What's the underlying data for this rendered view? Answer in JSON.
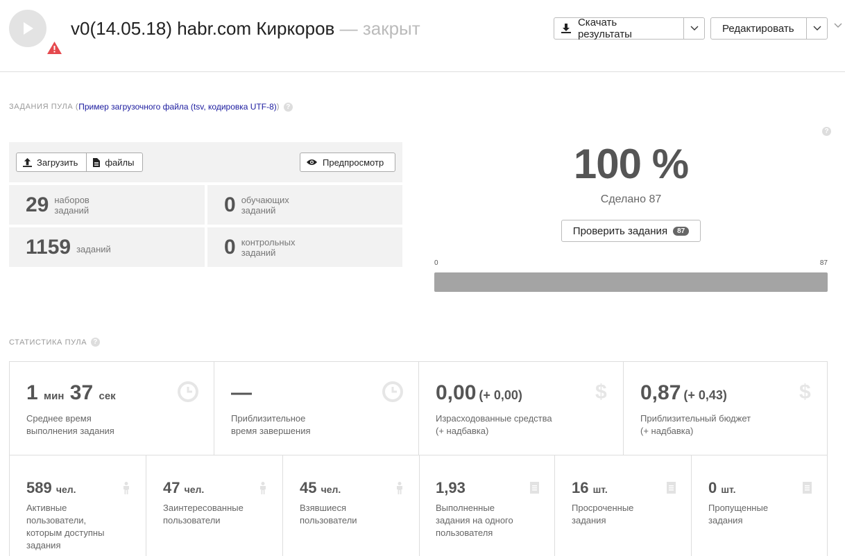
{
  "header": {
    "title": "v0(14.05.18) habr.com Киркоров",
    "status": "— закрыт",
    "download_label": "Скачать результаты",
    "edit_label": "Редактировать"
  },
  "tasks_section": {
    "label": "Задания пула (",
    "link": "Пример загрузочного файла (tsv, кодировка UTF-8)",
    "label_end": ")",
    "upload_label": "Загрузить",
    "files_label": "файлы",
    "preview_label": "Предпросмотр",
    "stats": [
      {
        "num": "29",
        "label_1": "наборов",
        "label_2": "заданий"
      },
      {
        "num": "0",
        "label_1": "обучающих",
        "label_2": "заданий"
      },
      {
        "num": "1159",
        "label_1": "заданий",
        "label_2": ""
      },
      {
        "num": "0",
        "label_1": "контрольных",
        "label_2": "заданий"
      }
    ]
  },
  "progress": {
    "percent": "100 %",
    "done_text": "Сделано 87",
    "check_label": "Проверить задания",
    "check_badge": "87",
    "scale_min": "0",
    "scale_max": "87",
    "fill_fraction": 1.0
  },
  "pool_stats": {
    "label": "Статистика пула",
    "big": [
      {
        "v1": "1",
        "u1": "мин",
        "v2": "37",
        "u2": "сек",
        "cap1": "Среднее время",
        "cap2": "выполнения задания",
        "icon": "clock-icon"
      },
      {
        "value": "—",
        "cap1": "Приблизительное",
        "cap2": "время завершения",
        "icon": "clock-icon"
      },
      {
        "value": "0,00",
        "extra": "(+ 0,00)",
        "cap1": "Израсходованные средства",
        "cap2": "(+ надбавка)",
        "icon": "dollar-icon"
      },
      {
        "value": "0,87",
        "extra": "(+ 0,43)",
        "cap1": "Приблизительный бюджет",
        "cap2": "(+ надбавка)",
        "icon": "dollar-icon"
      }
    ],
    "small": [
      {
        "value": "589",
        "unit": "чел.",
        "cap": [
          "Активные",
          "пользователи,",
          "которым доступны",
          "задания"
        ],
        "icon": "person-icon"
      },
      {
        "value": "47",
        "unit": "чел.",
        "cap": [
          "Заинтересованные",
          "пользователи"
        ],
        "icon": "person-icon"
      },
      {
        "value": "45",
        "unit": "чел.",
        "cap": [
          "Взявшиеся",
          "пользователи"
        ],
        "icon": "person-icon"
      },
      {
        "value": "1,93",
        "unit": "",
        "cap": [
          "Выполненные",
          "задания на одного",
          "пользователя"
        ],
        "icon": "document-icon"
      },
      {
        "value": "16",
        "unit": "шт.",
        "cap": [
          "Просроченные",
          "задания"
        ],
        "icon": "document-icon"
      },
      {
        "value": "0",
        "unit": "шт.",
        "cap": [
          "Пропущенные",
          "задания"
        ],
        "icon": "document-icon"
      }
    ]
  },
  "colors": {
    "link": "#1a1a9e",
    "warning": "#e5484d",
    "bar_fill": "#a4a4a4",
    "panel_bg": "#f2f2f2"
  }
}
